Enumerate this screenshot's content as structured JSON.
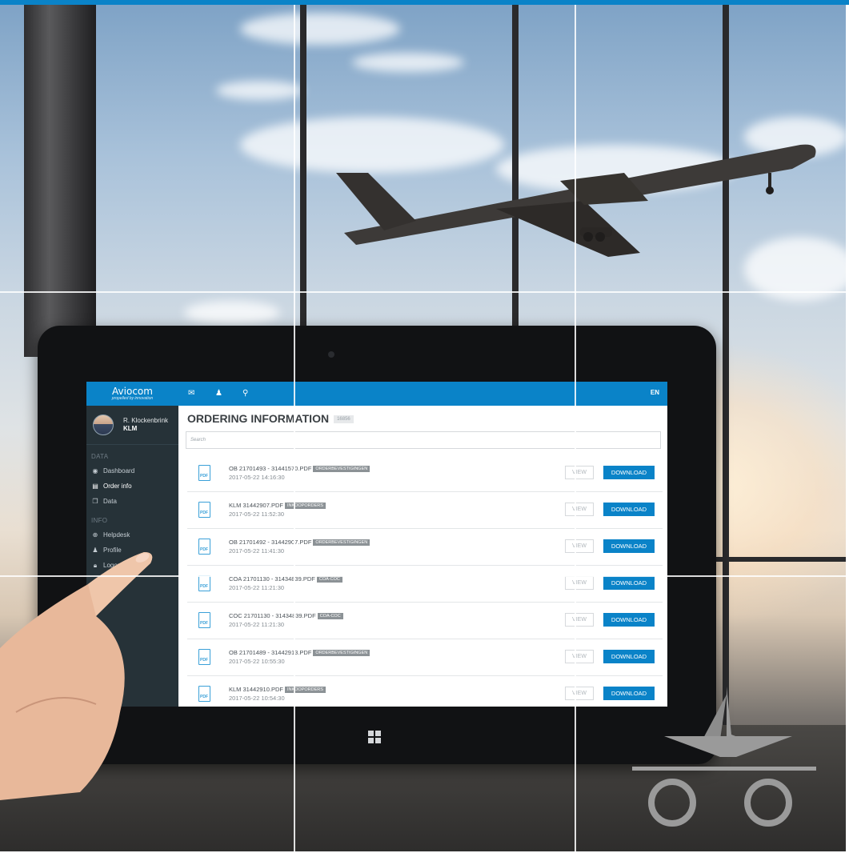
{
  "app": {
    "logo_name": "Aviocom",
    "logo_tagline": "propelled by innovation",
    "language": "EN"
  },
  "user": {
    "name": "R. Klockenbrink",
    "org": "KLM"
  },
  "nav": {
    "section_data": "DATA",
    "section_info": "INFO",
    "items": [
      {
        "label": "Dashboard",
        "icon": "dashboard-icon"
      },
      {
        "label": "Order info",
        "icon": "document-icon"
      },
      {
        "label": "Data",
        "icon": "files-icon"
      },
      {
        "label": "Helpdesk",
        "icon": "lifebuoy-icon"
      },
      {
        "label": "Profile",
        "icon": "user-icon"
      },
      {
        "label": "Logout",
        "icon": "lock-icon"
      }
    ]
  },
  "topbar": {
    "icons": [
      "envelope-icon",
      "user-icon",
      "search-icon"
    ]
  },
  "main": {
    "title": "ORDERING INFORMATION",
    "count": "16856",
    "search_placeholder": "Search",
    "view_label": "VIEW",
    "download_label": "DOWNLOAD",
    "file_icon_label": "PDF"
  },
  "files": [
    {
      "name": "OB 21701493 - 31441570.PDF",
      "tag": "ORDERBEVESTIGINGEN",
      "date": "2017-05-22 14:16:30"
    },
    {
      "name": "KLM 31442907.PDF",
      "tag": "INKOOPORDERS",
      "date": "2017-05-22 11:52:30"
    },
    {
      "name": "OB 21701492 - 31442907.PDF",
      "tag": "ORDERBEVESTIGINGEN",
      "date": "2017-05-22 11:41:30"
    },
    {
      "name": "COA 21701130 - 31434839.PDF",
      "tag": "COA-COC",
      "date": "2017-05-22 11:21:30"
    },
    {
      "name": "COC 21701130 - 31434839.PDF",
      "tag": "COA-COC",
      "date": "2017-05-22 11:21:30"
    },
    {
      "name": "OB 21701489 - 31442913.PDF",
      "tag": "ORDERBEVESTIGINGEN",
      "date": "2017-05-22 10:55:30"
    },
    {
      "name": "KLM 31442910.PDF",
      "tag": "INKOOPORDERS",
      "date": "2017-05-22 10:54:30"
    }
  ],
  "colors": {
    "accent": "#0a83c8",
    "sidebar": "#263238",
    "badge": "#8c9296"
  }
}
